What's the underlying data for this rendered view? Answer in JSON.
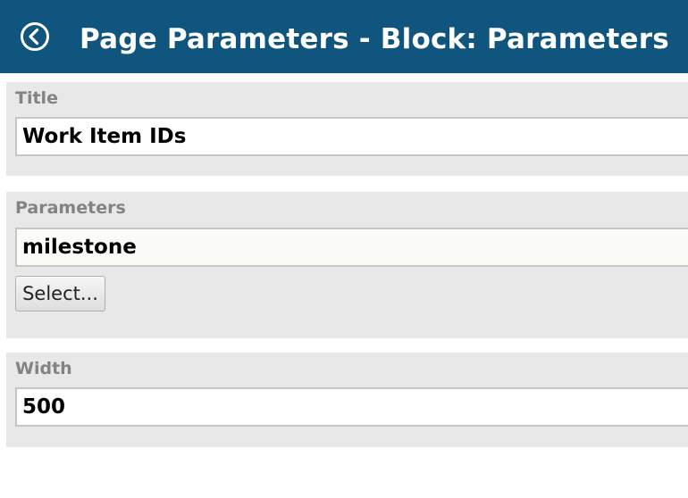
{
  "header": {
    "title": "Page Parameters - Block: Parameters",
    "back_icon": "back-circle-arrow-icon",
    "background_color": "#10557d"
  },
  "sections": {
    "title": {
      "label": "Title",
      "value": "Work Item IDs"
    },
    "parameters": {
      "label": "Parameters",
      "value": "milestone",
      "select_button_label": "Select..."
    },
    "width": {
      "label": "Width",
      "value": "500"
    }
  }
}
